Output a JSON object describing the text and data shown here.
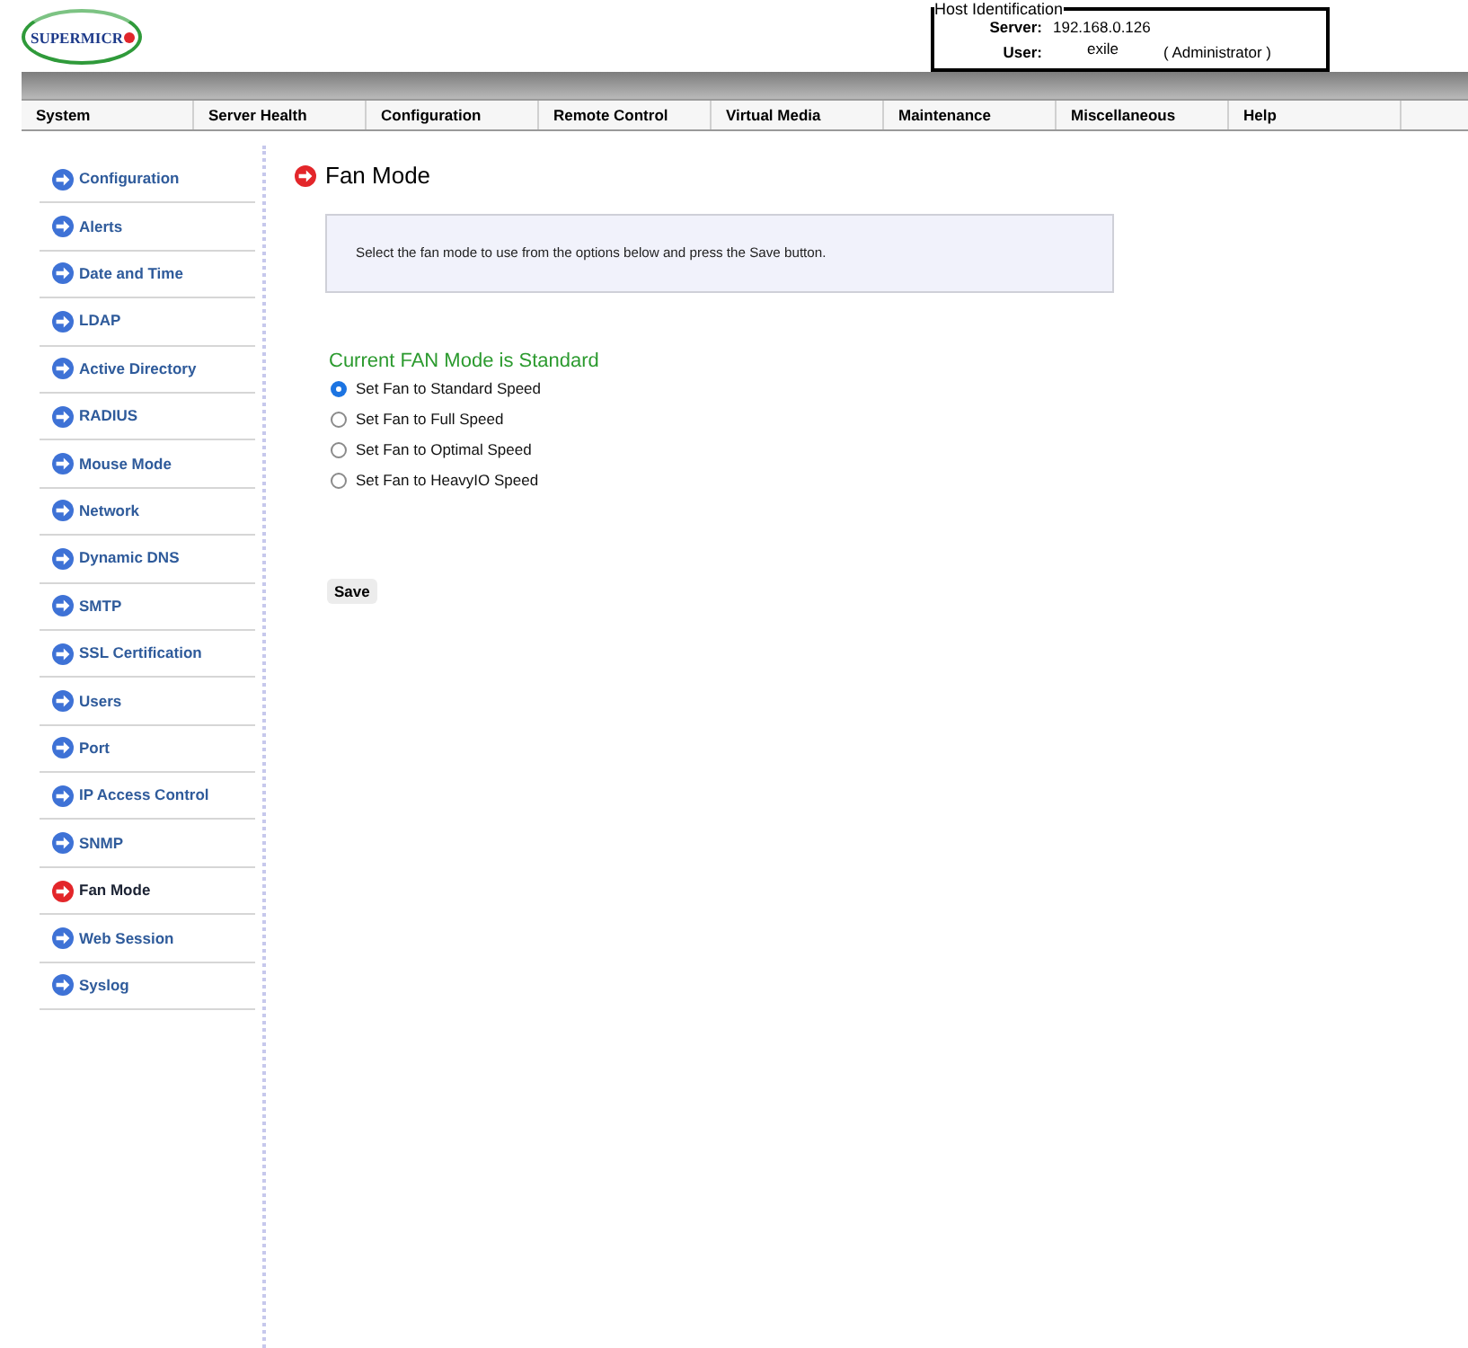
{
  "logo": {
    "text": "SUPERMICR"
  },
  "host_identification": {
    "title": "Host Identification",
    "server_label": "Server:",
    "server": "192.168.0.126",
    "user_label": "User:",
    "user": "exile",
    "role": "( Administrator )"
  },
  "menu": [
    "System",
    "Server Health",
    "Configuration",
    "Remote Control",
    "Virtual Media",
    "Maintenance",
    "Miscellaneous",
    "Help"
  ],
  "sidebar": {
    "items": [
      {
        "label": "Configuration",
        "selected": false
      },
      {
        "label": "Alerts",
        "selected": false
      },
      {
        "label": "Date and Time",
        "selected": false
      },
      {
        "label": "LDAP",
        "selected": false
      },
      {
        "label": "Active Directory",
        "selected": false
      },
      {
        "label": "RADIUS",
        "selected": false
      },
      {
        "label": "Mouse Mode",
        "selected": false
      },
      {
        "label": "Network",
        "selected": false
      },
      {
        "label": "Dynamic DNS",
        "selected": false
      },
      {
        "label": "SMTP",
        "selected": false
      },
      {
        "label": "SSL Certification",
        "selected": false
      },
      {
        "label": "Users",
        "selected": false
      },
      {
        "label": "Port",
        "selected": false
      },
      {
        "label": "IP Access Control",
        "selected": false
      },
      {
        "label": "SNMP",
        "selected": false
      },
      {
        "label": "Fan Mode",
        "selected": true
      },
      {
        "label": "Web Session",
        "selected": false
      },
      {
        "label": "Syslog",
        "selected": false
      }
    ]
  },
  "page": {
    "title": "Fan Mode",
    "info": "Select the fan mode to use from the options below and press the Save button.",
    "current_mode": "Current FAN Mode is Standard",
    "options": [
      {
        "label": "Set Fan to Standard Speed",
        "selected": true
      },
      {
        "label": "Set Fan to Full Speed",
        "selected": false
      },
      {
        "label": "Set Fan to Optimal Speed",
        "selected": false
      },
      {
        "label": "Set Fan to HeavyIO Speed",
        "selected": false
      }
    ],
    "save_button": "Save"
  }
}
